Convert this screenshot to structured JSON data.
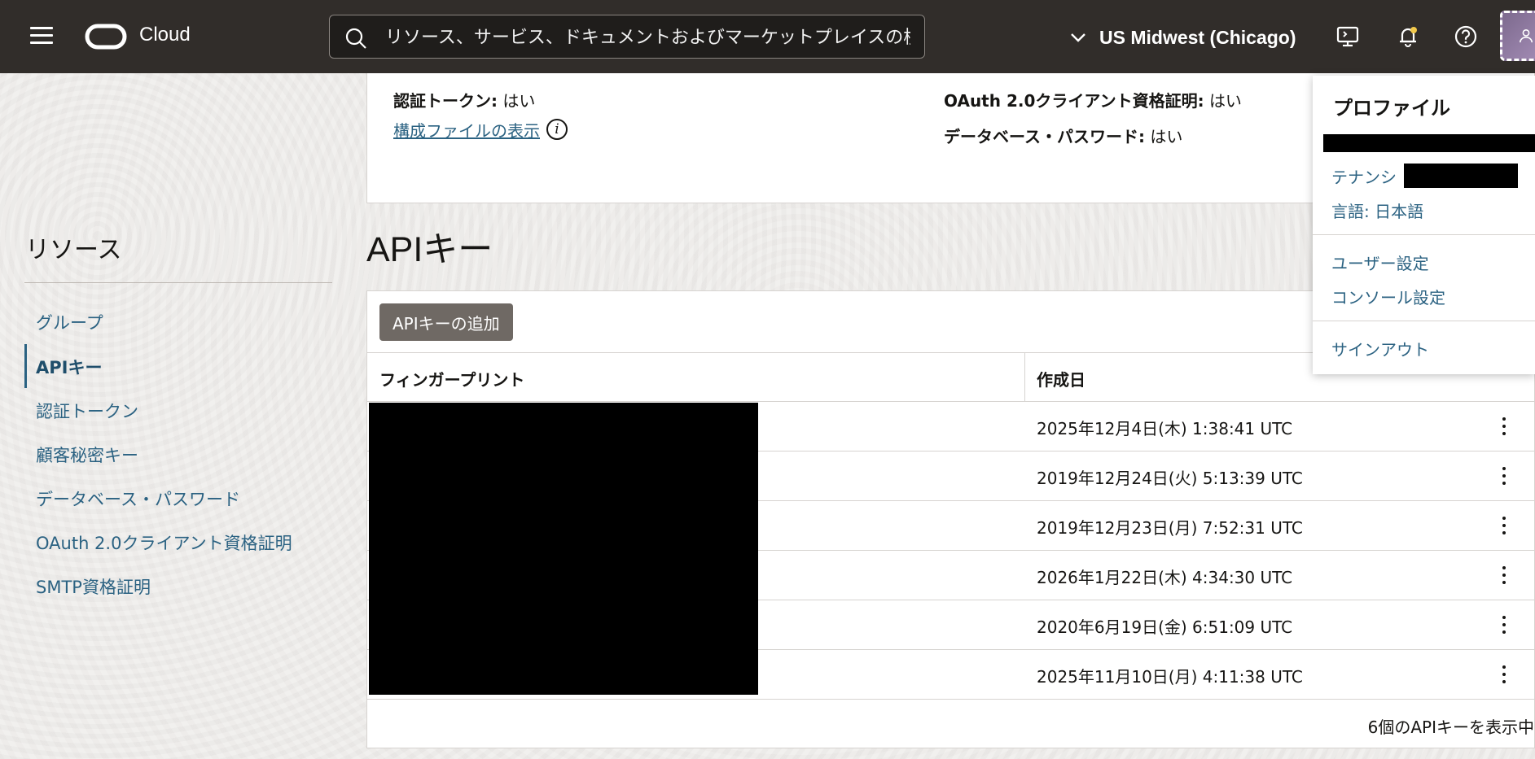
{
  "topbar": {
    "logo_text": "Cloud",
    "search_placeholder": "リソース、サービス、ドキュメントおよびマーケットプレイスの検",
    "region": "US Midwest (Chicago)"
  },
  "sidebar": {
    "title": "リソース",
    "items": [
      {
        "label": "グループ",
        "active": false
      },
      {
        "label": "APIキー",
        "active": true
      },
      {
        "label": "認証トークン",
        "active": false
      },
      {
        "label": "顧客秘密キー",
        "active": false
      },
      {
        "label": "データベース・パスワード",
        "active": false
      },
      {
        "label": "OAuth 2.0クライアント資格証明",
        "active": false
      },
      {
        "label": "SMTP資格証明",
        "active": false
      }
    ]
  },
  "info": {
    "auth_token_label": "認証トークン:",
    "auth_token_value": "はい",
    "config_link": "構成ファイルの表示",
    "oauth_label": "OAuth 2.0クライアント資格証明:",
    "oauth_value": "はい",
    "dbpw_label": "データベース・パスワード:",
    "dbpw_value": "はい"
  },
  "api_keys": {
    "heading": "APIキー",
    "add_button": "APIキーの追加",
    "columns": [
      "フィンガープリント",
      "作成日"
    ],
    "rows": [
      {
        "created": "2025年12月4日(木) 1:38:41 UTC"
      },
      {
        "created": "2019年12月24日(火) 5:13:39 UTC"
      },
      {
        "created": "2019年12月23日(月) 7:52:31 UTC"
      },
      {
        "created": "2026年1月22日(木) 4:34:30 UTC"
      },
      {
        "created": "2020年6月19日(金) 6:51:09 UTC"
      },
      {
        "created": "2025年11月10日(月) 4:11:38 UTC"
      }
    ],
    "footer": "6個のAPIキーを表示中"
  },
  "profile_menu": {
    "title": "プロファイル",
    "tenancy_label": "テナンシ",
    "language": "言語: 日本語",
    "user_settings": "ユーザー設定",
    "console_settings": "コンソール設定",
    "sign_out": "サインアウト"
  }
}
